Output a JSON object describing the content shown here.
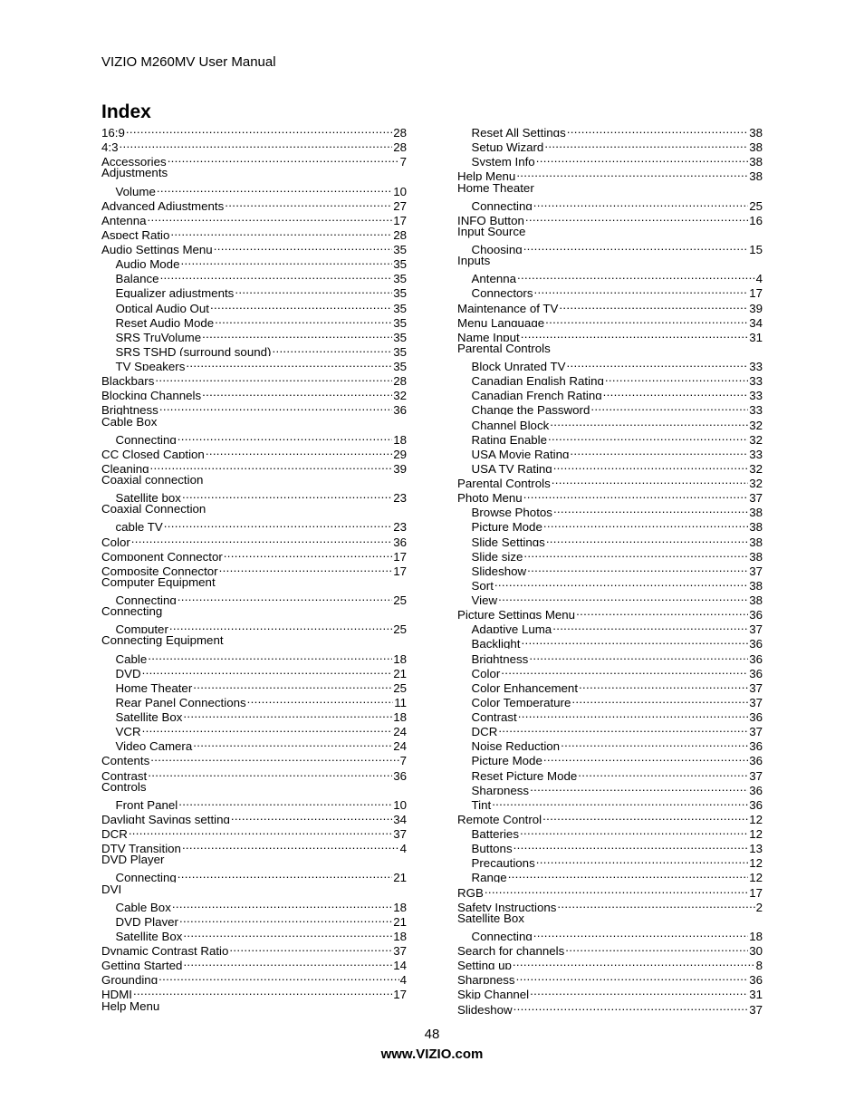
{
  "header": {
    "title": "VIZIO M260MV User Manual"
  },
  "page_title": "Index",
  "left_column": [
    {
      "term": "16:9",
      "page": "28",
      "level": 0
    },
    {
      "term": "4:3",
      "page": "28",
      "level": 0
    },
    {
      "term": "Accessories",
      "page": "7",
      "level": 0
    },
    {
      "term": "Adjustments",
      "page": "",
      "level": 0
    },
    {
      "term": "Volume",
      "page": "10",
      "level": 1
    },
    {
      "term": "Advanced Adjustments",
      "page": "27",
      "level": 0
    },
    {
      "term": "Antenna",
      "page": "17",
      "level": 0
    },
    {
      "term": "Aspect Ratio",
      "page": "28",
      "level": 0
    },
    {
      "term": "Audio Settings Menu",
      "page": "35",
      "level": 0
    },
    {
      "term": "Audio Mode",
      "page": "35",
      "level": 1
    },
    {
      "term": "Balance",
      "page": "35",
      "level": 1
    },
    {
      "term": "Equalizer adjustments",
      "page": "35",
      "level": 1
    },
    {
      "term": "Optical Audio Out",
      "page": "35",
      "level": 1
    },
    {
      "term": "Reset Audio Mode",
      "page": "35",
      "level": 1
    },
    {
      "term": "SRS TruVolume",
      "page": "35",
      "level": 1
    },
    {
      "term": "SRS TSHD (surround sound)",
      "page": "35",
      "level": 1
    },
    {
      "term": "TV Speakers",
      "page": "35",
      "level": 1
    },
    {
      "term": "Blackbars",
      "page": "28",
      "level": 0
    },
    {
      "term": "Blocking Channels",
      "page": "32",
      "level": 0
    },
    {
      "term": "Brightness",
      "page": "36",
      "level": 0
    },
    {
      "term": "Cable Box",
      "page": "",
      "level": 0
    },
    {
      "term": "Connecting",
      "page": "18",
      "level": 1
    },
    {
      "term": "CC Closed Caption",
      "page": "29",
      "level": 0
    },
    {
      "term": "Cleaning",
      "page": "39",
      "level": 0
    },
    {
      "term": "Coaxial connection",
      "page": "",
      "level": 0
    },
    {
      "term": "Satellite box",
      "page": "23",
      "level": 1
    },
    {
      "term": "Coaxial Connection",
      "page": "",
      "level": 0
    },
    {
      "term": "cable TV",
      "page": "23",
      "level": 1
    },
    {
      "term": "Color",
      "page": "36",
      "level": 0
    },
    {
      "term": "Component Connector",
      "page": "17",
      "level": 0
    },
    {
      "term": "Composite Connector",
      "page": "17",
      "level": 0
    },
    {
      "term": "Computer Equipment",
      "page": "",
      "level": 0
    },
    {
      "term": "Connecting",
      "page": "25",
      "level": 1
    },
    {
      "term": "Connecting",
      "page": "",
      "level": 0
    },
    {
      "term": "Computer",
      "page": "25",
      "level": 1
    },
    {
      "term": "Connecting Equipment",
      "page": "",
      "level": 0
    },
    {
      "term": "Cable",
      "page": "18",
      "level": 1
    },
    {
      "term": "DVD",
      "page": "21",
      "level": 1
    },
    {
      "term": "Home Theater",
      "page": "25",
      "level": 1
    },
    {
      "term": "Rear Panel Connections",
      "page": "11",
      "level": 1
    },
    {
      "term": "Satellite Box",
      "page": "18",
      "level": 1
    },
    {
      "term": "VCR",
      "page": "24",
      "level": 1
    },
    {
      "term": "Video Camera",
      "page": "24",
      "level": 1
    },
    {
      "term": "Contents",
      "page": "7",
      "level": 0
    },
    {
      "term": "Contrast",
      "page": "36",
      "level": 0
    },
    {
      "term": "Controls",
      "page": "",
      "level": 0
    },
    {
      "term": "Front Panel",
      "page": "10",
      "level": 1
    },
    {
      "term": "Daylight Savings setting",
      "page": "34",
      "level": 0
    },
    {
      "term": "DCR",
      "page": "37",
      "level": 0
    },
    {
      "term": "DTV Transition",
      "page": "4",
      "level": 0
    },
    {
      "term": "DVD Player",
      "page": "",
      "level": 0
    },
    {
      "term": "Connecting",
      "page": "21",
      "level": 1
    },
    {
      "term": "DVI",
      "page": "",
      "level": 0
    },
    {
      "term": "Cable Box",
      "page": "18",
      "level": 1
    },
    {
      "term": "DVD Player",
      "page": "21",
      "level": 1
    },
    {
      "term": "Satellite Box",
      "page": "18",
      "level": 1
    },
    {
      "term": "Dynamic Contrast Ratio",
      "page": "37",
      "level": 0
    },
    {
      "term": "Getting Started",
      "page": "14",
      "level": 0
    },
    {
      "term": "Grounding",
      "page": "4",
      "level": 0
    },
    {
      "term": "HDMI",
      "page": "17",
      "level": 0
    },
    {
      "term": "Help Menu",
      "page": "",
      "level": 0
    }
  ],
  "right_column": [
    {
      "term": "Reset All Settings",
      "page": "38",
      "level": 1
    },
    {
      "term": "Setup Wizard",
      "page": "38",
      "level": 1
    },
    {
      "term": "System Info",
      "page": "38",
      "level": 1
    },
    {
      "term": "Help Menu",
      "page": "38",
      "level": 0
    },
    {
      "term": "Home Theater",
      "page": "",
      "level": 0
    },
    {
      "term": "Connecting",
      "page": "25",
      "level": 1
    },
    {
      "term": "INFO Button",
      "page": "16",
      "level": 0
    },
    {
      "term": "Input Source",
      "page": "",
      "level": 0
    },
    {
      "term": "Choosing",
      "page": "15",
      "level": 1
    },
    {
      "term": "Inputs",
      "page": "",
      "level": 0
    },
    {
      "term": "Antenna",
      "page": "4",
      "level": 1
    },
    {
      "term": "Connectors",
      "page": "17",
      "level": 1
    },
    {
      "term": "Maintenance of TV",
      "page": "39",
      "level": 0
    },
    {
      "term": "Menu Language",
      "page": "34",
      "level": 0
    },
    {
      "term": "Name Input",
      "page": "31",
      "level": 0
    },
    {
      "term": "Parental Controls",
      "page": "",
      "level": 0
    },
    {
      "term": "Block Unrated TV",
      "page": "33",
      "level": 1
    },
    {
      "term": "Canadian English Rating",
      "page": "33",
      "level": 1
    },
    {
      "term": "Canadian French Rating",
      "page": "33",
      "level": 1
    },
    {
      "term": "Change the Password",
      "page": "33",
      "level": 1
    },
    {
      "term": "Channel Block",
      "page": "32",
      "level": 1
    },
    {
      "term": "Rating Enable",
      "page": "32",
      "level": 1
    },
    {
      "term": "USA Movie Rating",
      "page": "33",
      "level": 1
    },
    {
      "term": "USA TV Rating",
      "page": "32",
      "level": 1
    },
    {
      "term": "Parental Controls",
      "page": "32",
      "level": 0
    },
    {
      "term": "Photo Menu",
      "page": "37",
      "level": 0
    },
    {
      "term": "Browse Photos",
      "page": "38",
      "level": 1
    },
    {
      "term": "Picture Mode",
      "page": "38",
      "level": 1
    },
    {
      "term": "Slide Settings",
      "page": "38",
      "level": 1
    },
    {
      "term": "Slide size",
      "page": "38",
      "level": 1
    },
    {
      "term": "Slideshow",
      "page": "37",
      "level": 1
    },
    {
      "term": "Sort",
      "page": "38",
      "level": 1
    },
    {
      "term": "View",
      "page": "38",
      "level": 1
    },
    {
      "term": "Picture Settings Menu",
      "page": "36",
      "level": 0
    },
    {
      "term": "Adaptive Luma",
      "page": "37",
      "level": 1
    },
    {
      "term": "Backlight",
      "page": "36",
      "level": 1
    },
    {
      "term": "Brightness",
      "page": "36",
      "level": 1
    },
    {
      "term": "Color",
      "page": "36",
      "level": 1
    },
    {
      "term": "Color Enhancement",
      "page": "37",
      "level": 1
    },
    {
      "term": "Color Temperature",
      "page": "37",
      "level": 1
    },
    {
      "term": "Contrast",
      "page": "36",
      "level": 1
    },
    {
      "term": "DCR",
      "page": "37",
      "level": 1
    },
    {
      "term": "Noise Reduction",
      "page": "36",
      "level": 1
    },
    {
      "term": "Picture Mode",
      "page": "36",
      "level": 1
    },
    {
      "term": "Reset Picture Mode",
      "page": "37",
      "level": 1
    },
    {
      "term": "Sharpness",
      "page": "36",
      "level": 1
    },
    {
      "term": "Tint",
      "page": "36",
      "level": 1
    },
    {
      "term": "Remote Control",
      "page": "12",
      "level": 0
    },
    {
      "term": "Batteries",
      "page": "12",
      "level": 1
    },
    {
      "term": "Buttons",
      "page": "13",
      "level": 1
    },
    {
      "term": "Precautions",
      "page": "12",
      "level": 1
    },
    {
      "term": "Range",
      "page": "12",
      "level": 1
    },
    {
      "term": "RGB",
      "page": "17",
      "level": 0
    },
    {
      "term": "Safety Instructions",
      "page": "2",
      "level": 0
    },
    {
      "term": "Satellite Box",
      "page": "",
      "level": 0
    },
    {
      "term": "Connecting",
      "page": "18",
      "level": 1
    },
    {
      "term": "Search for channels",
      "page": "30",
      "level": 0
    },
    {
      "term": "Setting up",
      "page": "8",
      "level": 0
    },
    {
      "term": "Sharpness",
      "page": "36",
      "level": 0
    },
    {
      "term": "Skip Channel",
      "page": "31",
      "level": 0
    },
    {
      "term": "Slideshow",
      "page": "37",
      "level": 0
    }
  ],
  "footer": {
    "page_number": "48",
    "website": "www.VIZIO.com"
  }
}
